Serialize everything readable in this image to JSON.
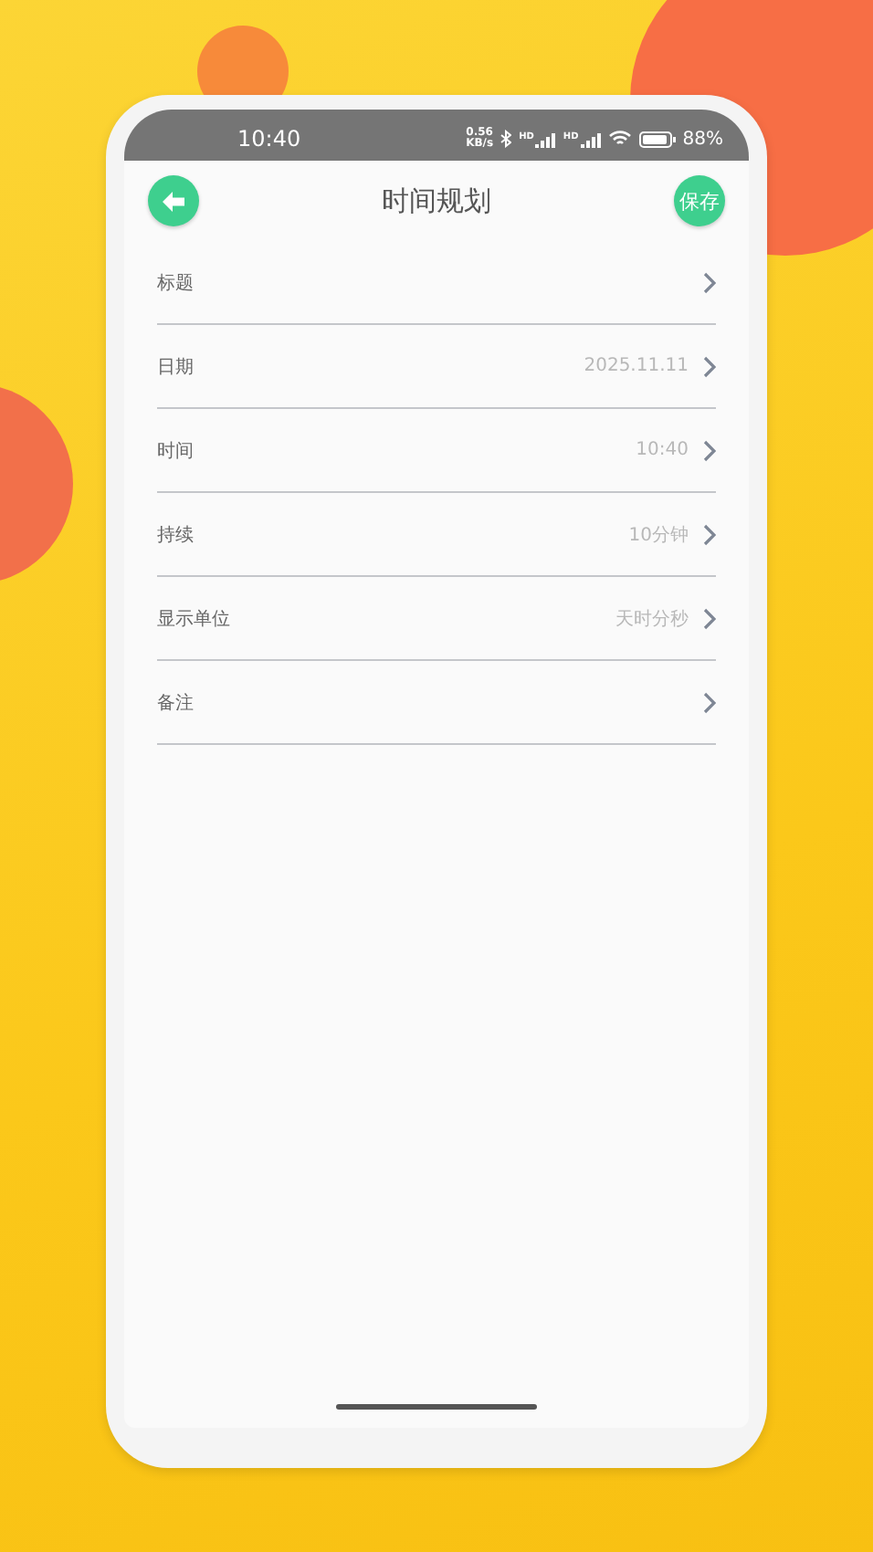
{
  "status_bar": {
    "time": "10:40",
    "net_speed": "0.56",
    "net_unit": "KB/s",
    "signals": [
      "HD",
      "HD"
    ],
    "battery": "88%"
  },
  "header": {
    "title": "时间规划",
    "save_button": "保存"
  },
  "rows": [
    {
      "label": "标题",
      "value": null
    },
    {
      "label": "日期",
      "value": "2025.11.11"
    },
    {
      "label": "时间",
      "value": "10:40"
    },
    {
      "label": "持续",
      "value": "10分钟"
    },
    {
      "label": "显示单位",
      "value": "天时分秒"
    },
    {
      "label": "备注",
      "value": null
    }
  ]
}
